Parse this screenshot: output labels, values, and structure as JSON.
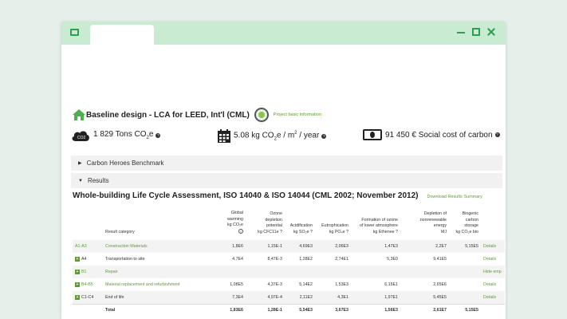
{
  "window": {
    "accent": "#2e9e4f",
    "titlebar_color": "#c9ebd2"
  },
  "design": {
    "title": "Baseline design - LCA for LEED, Int'l (CML)",
    "project_link": "Project basic information"
  },
  "kpis": [
    {
      "value_pre": "1 829 Tons CO",
      "sub": "2",
      "value_post": "e",
      "icon": "cloud-co2-icon"
    },
    {
      "value_pre": "5.08 kg CO",
      "sub": "2",
      "value_mid": "e / m",
      "sup": "2",
      "value_post": " / year",
      "icon": "calendar-icon"
    },
    {
      "value_pre": "91 450 € Social cost of carbon",
      "icon": "money-icon"
    }
  ],
  "sections": [
    {
      "label": "Carbon Heroes Benchmark",
      "caret": "▶"
    },
    {
      "label": "Results",
      "caret": "▼"
    }
  ],
  "results": {
    "title": "Whole-building Life Cycle Assessment, ISO 14040 & ISO 14044 (CML 2002; November 2012)",
    "download_link": "Download Results Summary",
    "columns": [
      {
        "l1": "",
        "l2": "",
        "l3": "",
        "l4": ""
      },
      {
        "l1": "",
        "l2": "",
        "l3": "",
        "l4": "Result category"
      },
      {
        "l1": "Global",
        "l2": "warming",
        "l3": "kg CO₂e",
        "l4": "?"
      },
      {
        "l1": "Ozone",
        "l2": "depletion",
        "l3": "potential",
        "l4": "kg CFC11e ?"
      },
      {
        "l1": "",
        "l2": "",
        "l3": "Acidification",
        "l4": "kg SO₂e ?"
      },
      {
        "l1": "",
        "l2": "",
        "l3": "Eutrophication",
        "l4": "kg PO₄e ?"
      },
      {
        "l1": "",
        "l2": "Formation of ozone",
        "l3": "of lower atmosphere",
        "l4": "kg Ethenee ?"
      },
      {
        "l1": "Depletion of",
        "l2": "nonrenewable",
        "l3": "energy",
        "l4": "MJ"
      },
      {
        "l1": "Biogenic",
        "l2": "carbon",
        "l3": "storage",
        "l4": "kg CO₂e bio"
      },
      {
        "l1": "",
        "l2": "",
        "l3": "",
        "l4": ""
      }
    ],
    "rows": [
      {
        "stage": "A1-A3",
        "category": "Construction Materials",
        "gw": "1,8E6",
        "od": "1,15E-1",
        "ac": "4,69E3",
        "eu": "2,06E3",
        "fo": "1,47E3",
        "de": "2,2E7",
        "bc": "5,15E5",
        "link": "Details"
      },
      {
        "stage": "A4",
        "category": "Transportation to site",
        "gw": "4,7E4",
        "od": "8,47E-3",
        "ac": "1,28E2",
        "eu": "2,74E1",
        "fo": "5,3E0",
        "de": "9,41E5",
        "bc": "",
        "link": "Details"
      },
      {
        "stage": "B1",
        "category": "Repair",
        "gw": "",
        "od": "",
        "ac": "",
        "eu": "",
        "fo": "",
        "de": "",
        "bc": "",
        "link": "Hide emp"
      },
      {
        "stage": "B4-B5",
        "category": "Material replacement and refurbishment",
        "gw": "1,08E5",
        "od": "4,37E-3",
        "ac": "5,14E2",
        "eu": "1,53E3",
        "fo": "6,15E1",
        "de": "2,65E6",
        "bc": "",
        "link": "Details"
      },
      {
        "stage": "C1-C4",
        "category": "End of life",
        "gw": "7,3E4",
        "od": "4,97E-4",
        "ac": "2,11E2",
        "eu": "4,3E1",
        "fo": "1,97E1",
        "de": "5,45E5",
        "bc": "",
        "link": "Details"
      }
    ],
    "total": {
      "label": "Total",
      "gw": "1,83E6",
      "od": "1,28E-1",
      "ac": "5,54E3",
      "eu": "3,67E3",
      "fo": "1,56E3",
      "de": "2,61E7",
      "bc": "5,15E5"
    }
  }
}
